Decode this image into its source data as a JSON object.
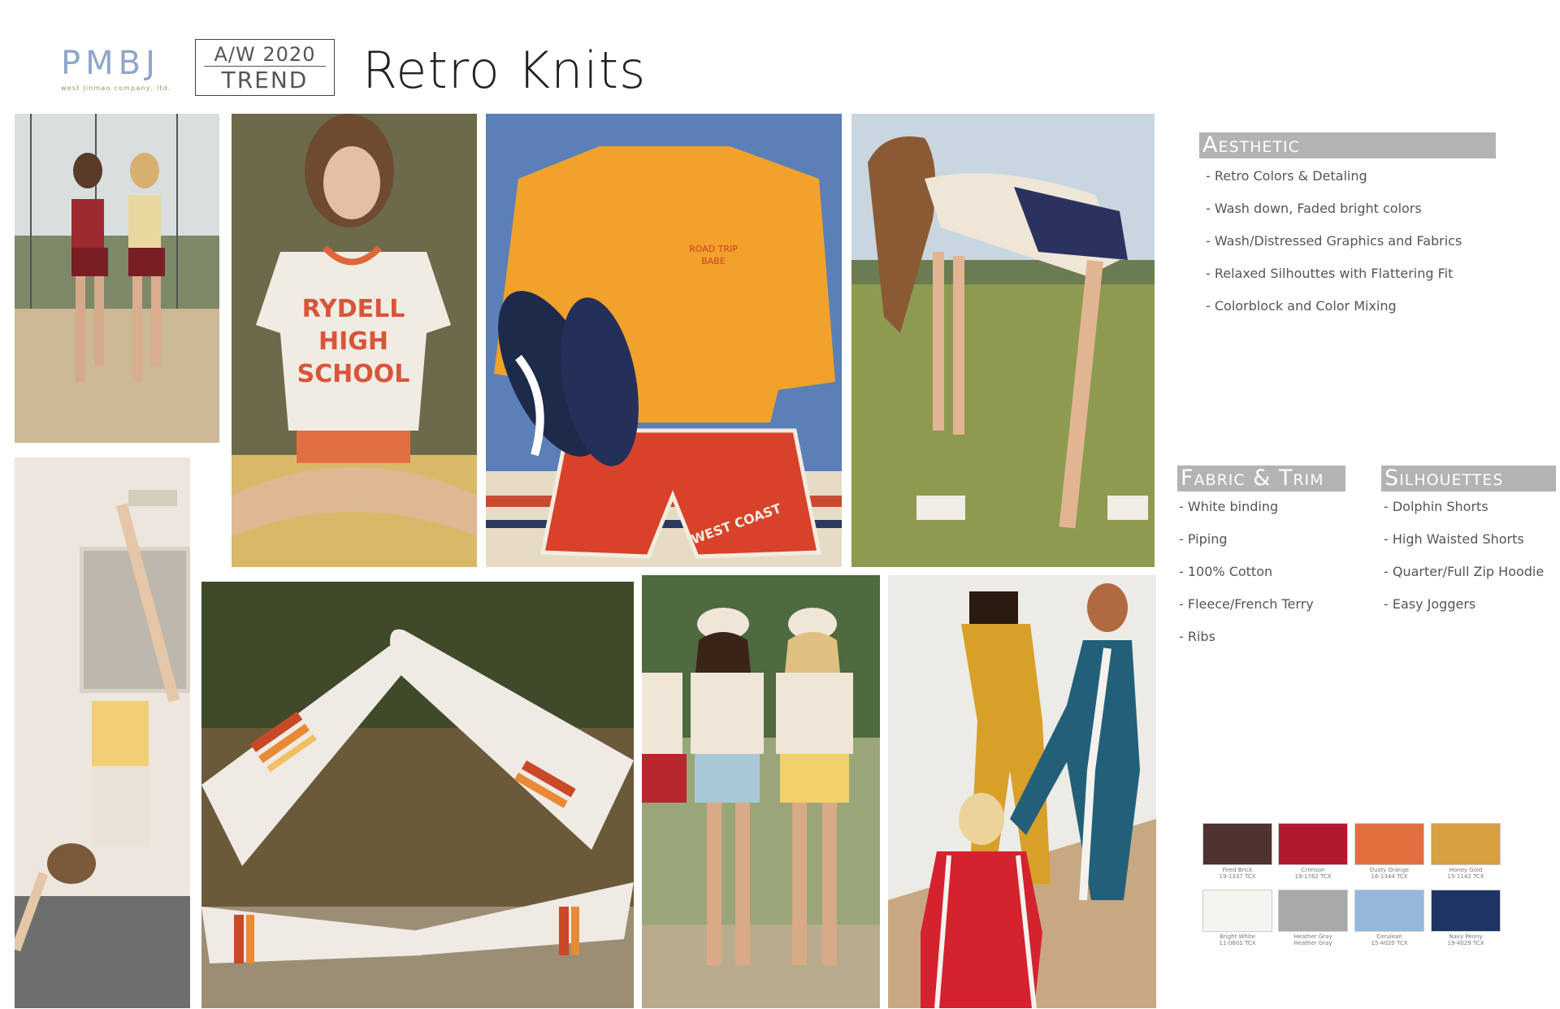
{
  "header": {
    "logo_initials": "PMBJ",
    "logo_subtitle": "west jinmao company, ltd.",
    "season": "A/W 2020",
    "trend_label": "TREND",
    "title": "Retro Knits"
  },
  "photos": [
    {
      "name": "photo-two-runners",
      "desc": "vintage runners"
    },
    {
      "name": "photo-rydell-tee"
    },
    {
      "name": "photo-orange-sweatshirt-flatlay"
    },
    {
      "name": "photo-stretching-girl"
    },
    {
      "name": "photo-handstand"
    },
    {
      "name": "photo-striped-socks"
    },
    {
      "name": "photo-three-girls-shorts"
    },
    {
      "name": "photo-tracksuits-group"
    }
  ],
  "aesthetic": {
    "heading": "Aesthetic",
    "items": [
      "- Retro Colors & Detaling",
      "- Wash down, Faded bright colors",
      "- Wash/Distressed Graphics and Fabrics",
      "- Relaxed Silhouttes with Flattering Fit",
      "- Colorblock and Color Mixing"
    ]
  },
  "fabric_trim": {
    "heading": "Fabric & Trim",
    "items": [
      "- White binding",
      "- Piping",
      "- 100% Cotton",
      "- Fleece/French Terry",
      "- Ribs"
    ]
  },
  "silhouettes": {
    "heading": "Silhouettes",
    "items": [
      "- Dolphin Shorts",
      "- High Waisted Shorts",
      "- Quarter/Full Zip Hoodie",
      "- Easy Joggers"
    ]
  },
  "swatches": [
    {
      "color": "#4e3330",
      "name": "Fired Brick",
      "code": "19-1337 TCX"
    },
    {
      "color": "#b2182f",
      "name": "Crimson",
      "code": "19-1762 TCX"
    },
    {
      "color": "#e2703f",
      "name": "Dusty Orange",
      "code": "16-1344 TCX"
    },
    {
      "color": "#d8a040",
      "name": "Honey Gold",
      "code": "15-1142 TCX"
    },
    {
      "color": "#f5f4ef",
      "name": "Bright White",
      "code": "11-0601 TCX"
    },
    {
      "color": "#a8a8a8",
      "name": "Heather Gray",
      "code": "Heather Gray"
    },
    {
      "color": "#96b7dc",
      "name": "Cerulean",
      "code": "15-4020 TCX"
    },
    {
      "color": "#1e3563",
      "name": "Navy Peony",
      "code": "19-4029 TCX"
    }
  ]
}
